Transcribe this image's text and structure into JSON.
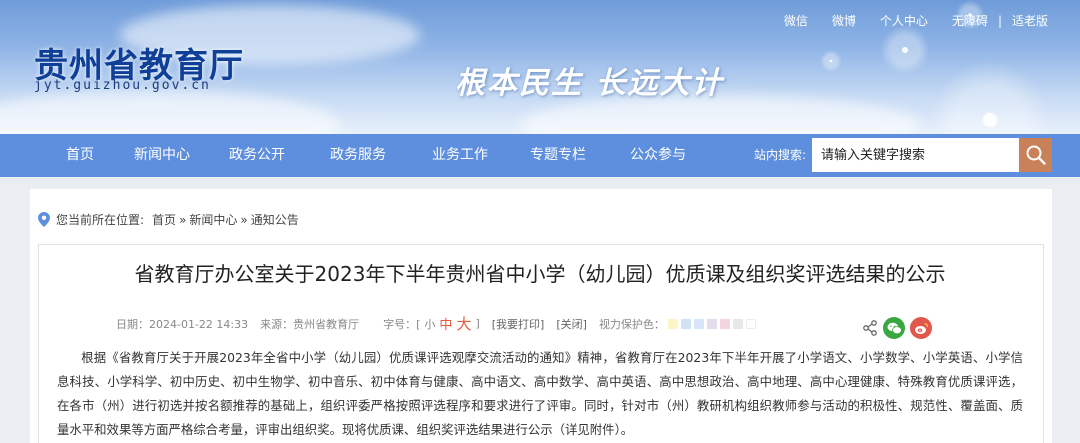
{
  "header": {
    "site_title": "贵州省教育厅",
    "site_domain": "jyt.guizhou.gov.cn",
    "slogan": "根本民生 长远大计",
    "top_links": {
      "weixin": "微信",
      "weibo": "微博",
      "personal_center": "个人中心",
      "accessibility": "无障碍",
      "separator": "|",
      "elderly_mode": "适老版"
    }
  },
  "nav": {
    "items": [
      "首页",
      "新闻中心",
      "政务公开",
      "政务服务",
      "业务工作",
      "专题专栏",
      "公众参与"
    ],
    "search_label": "站内搜索:",
    "search_placeholder": "请输入关键字搜索"
  },
  "breadcrumb": {
    "prefix": "您当前所在位置:",
    "items": [
      "首页",
      "新闻中心",
      "通知公告"
    ],
    "separator": "»"
  },
  "article": {
    "title": "省教育厅办公室关于2023年下半年贵州省中小学（幼儿园）优质课及组织奖评选结果的公示",
    "date": "日期：2024-01-22 14:33",
    "source": "来源：贵州省教育厅",
    "font_size_label": "字号：[",
    "font_small": "小",
    "font_medium": "中",
    "font_large": "大",
    "font_size_close": "]",
    "print_link": "[我要打印]",
    "close_link": "[关闭]",
    "eye_care_label": "视力保护色：",
    "eye_care_colors": [
      "#fbf6c8",
      "#cfe3f5",
      "#d7e4f9",
      "#e3dcef",
      "#f2d5e0",
      "#e8e8e8",
      "#ffffff"
    ],
    "body": "根据《省教育厅关于开展2023年全省中小学（幼儿园）优质课评选观摩交流活动的通知》精神，省教育厅在2023年下半年开展了小学语文、小学数学、小学英语、小学信息科技、小学科学、初中历史、初中生物学、初中音乐、初中体育与健康、高中语文、高中数学、高中英语、高中思想政治、高中地理、高中心理健康、特殊教育优质课评选，在各市（州）进行初选并按名额推荐的基础上，组织评委严格按照评选程序和要求进行了评审。同时，针对市（州）教研机构组织教师参与活动的积极性、规范性、覆盖面、质量水平和效果等方面严格综合考量，评审出组织奖。现将优质课、组织奖评选结果进行公示（详见附件）。"
  },
  "colors": {
    "nav_bg": "#5e8fdf",
    "title_blue": "#0f3f97",
    "search_button": "#c9815a",
    "font_size_accent": "#e15b3c",
    "wechat_green": "#3aa840",
    "weibo_red": "#e2574c"
  },
  "icons": {
    "search": "magnifier-icon",
    "location": "map-pin-icon",
    "share": "share-icon",
    "wechat": "wechat-icon",
    "weibo": "weibo-icon"
  }
}
